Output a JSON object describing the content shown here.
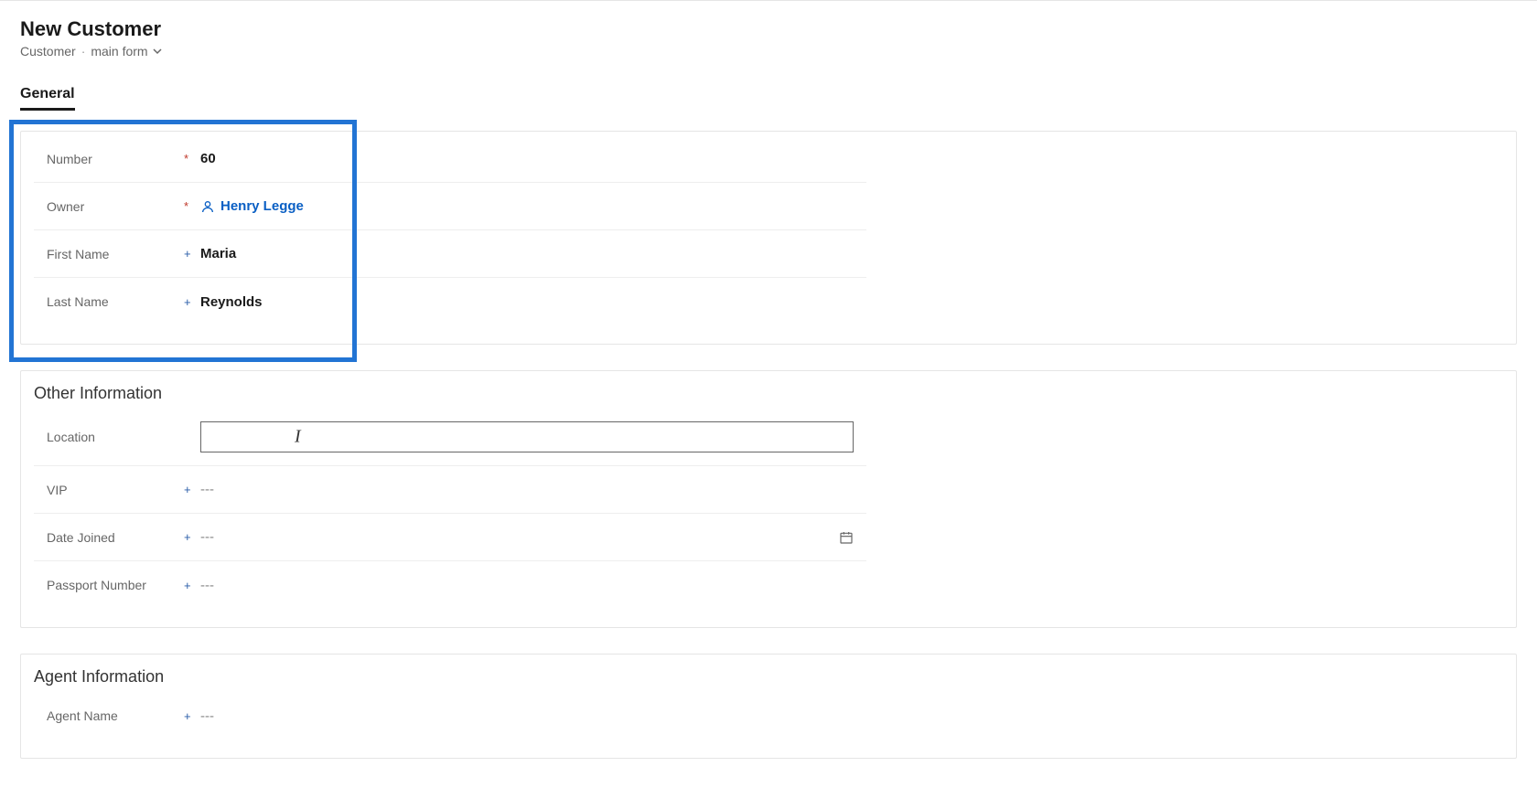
{
  "header": {
    "title": "New Customer",
    "entity": "Customer",
    "form_name": "main form"
  },
  "tabs": {
    "general": "General"
  },
  "general_section": {
    "fields": {
      "number": {
        "label": "Number",
        "value": "60"
      },
      "owner": {
        "label": "Owner",
        "value": "Henry Legge"
      },
      "first_name": {
        "label": "First Name",
        "value": "Maria"
      },
      "last_name": {
        "label": "Last Name",
        "value": "Reynolds"
      }
    }
  },
  "other_info_section": {
    "title": "Other Information",
    "fields": {
      "location": {
        "label": "Location",
        "value": ""
      },
      "vip": {
        "label": "VIP",
        "value": "---"
      },
      "date_joined": {
        "label": "Date Joined",
        "value": "---"
      },
      "passport_number": {
        "label": "Passport Number",
        "value": "---"
      }
    }
  },
  "agent_info_section": {
    "title": "Agent Information",
    "fields": {
      "agent_name": {
        "label": "Agent Name",
        "value": "---"
      }
    }
  }
}
